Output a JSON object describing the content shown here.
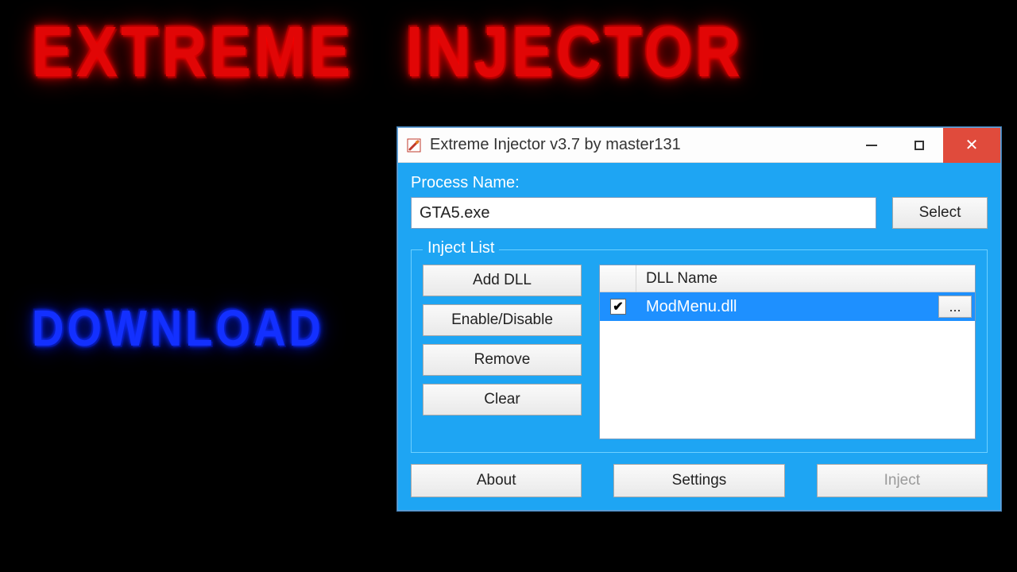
{
  "headline": {
    "red_word1": "Extreme",
    "red_word2": "Injector",
    "blue": "Download"
  },
  "window": {
    "title": "Extreme Injector v3.7 by master131"
  },
  "process": {
    "label": "Process Name:",
    "value": "GTA5.exe",
    "select_button": "Select"
  },
  "inject_list": {
    "legend": "Inject List",
    "buttons": {
      "add_dll": "Add DLL",
      "enable_disable": "Enable/Disable",
      "remove": "Remove",
      "clear": "Clear"
    },
    "header": "DLL Name",
    "rows": [
      {
        "checked": true,
        "name": "ModMenu.dll"
      }
    ],
    "dots": "..."
  },
  "bottom": {
    "about": "About",
    "settings": "Settings",
    "inject": "Inject"
  }
}
